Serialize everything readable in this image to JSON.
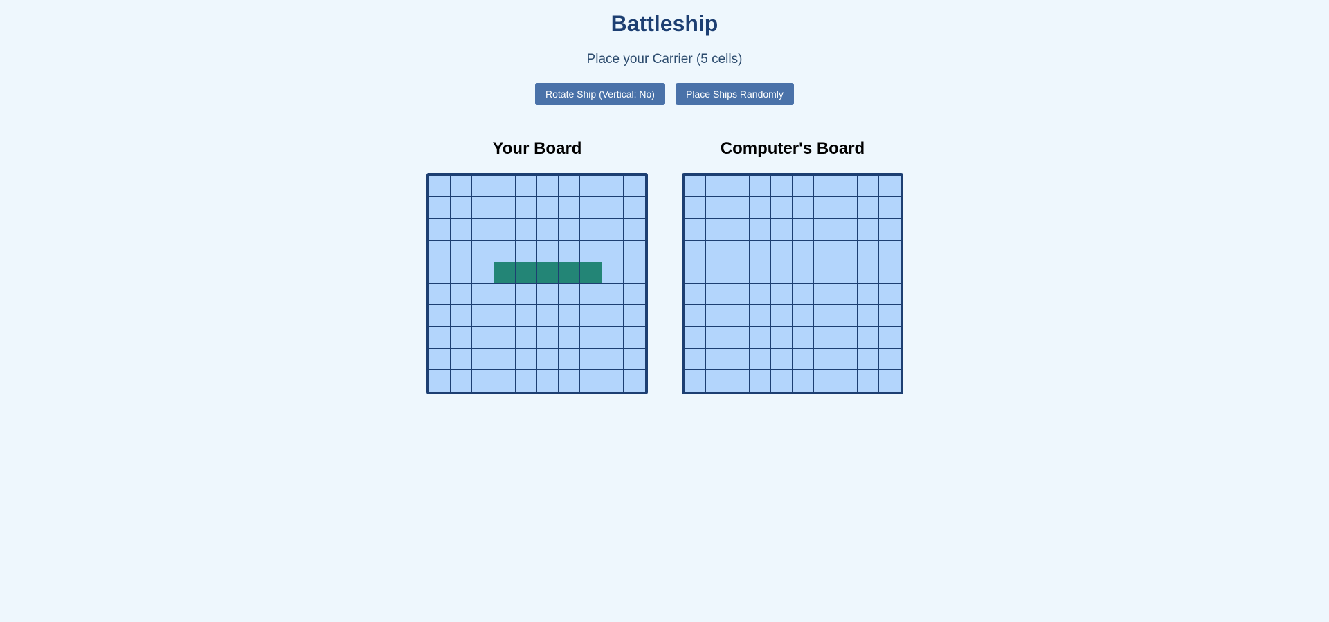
{
  "header": {
    "title": "Battleship",
    "status": "Place your Carrier (5 cells)"
  },
  "controls": {
    "rotate_label": "Rotate Ship (Vertical: No)",
    "random_label": "Place Ships Randomly"
  },
  "boards": {
    "player": {
      "title": "Your Board",
      "rows": 10,
      "cols": 10,
      "ship_cells": [
        [
          4,
          3
        ],
        [
          4,
          4
        ],
        [
          4,
          5
        ],
        [
          4,
          6
        ],
        [
          4,
          7
        ]
      ]
    },
    "computer": {
      "title": "Computer's Board",
      "rows": 10,
      "cols": 10,
      "ship_cells": []
    }
  },
  "colors": {
    "background": "#eef7fd",
    "title": "#1d3f72",
    "button": "#4a72a9",
    "water": "#b3d5fc",
    "ship": "#238576",
    "grid_border": "#1d3f72"
  }
}
